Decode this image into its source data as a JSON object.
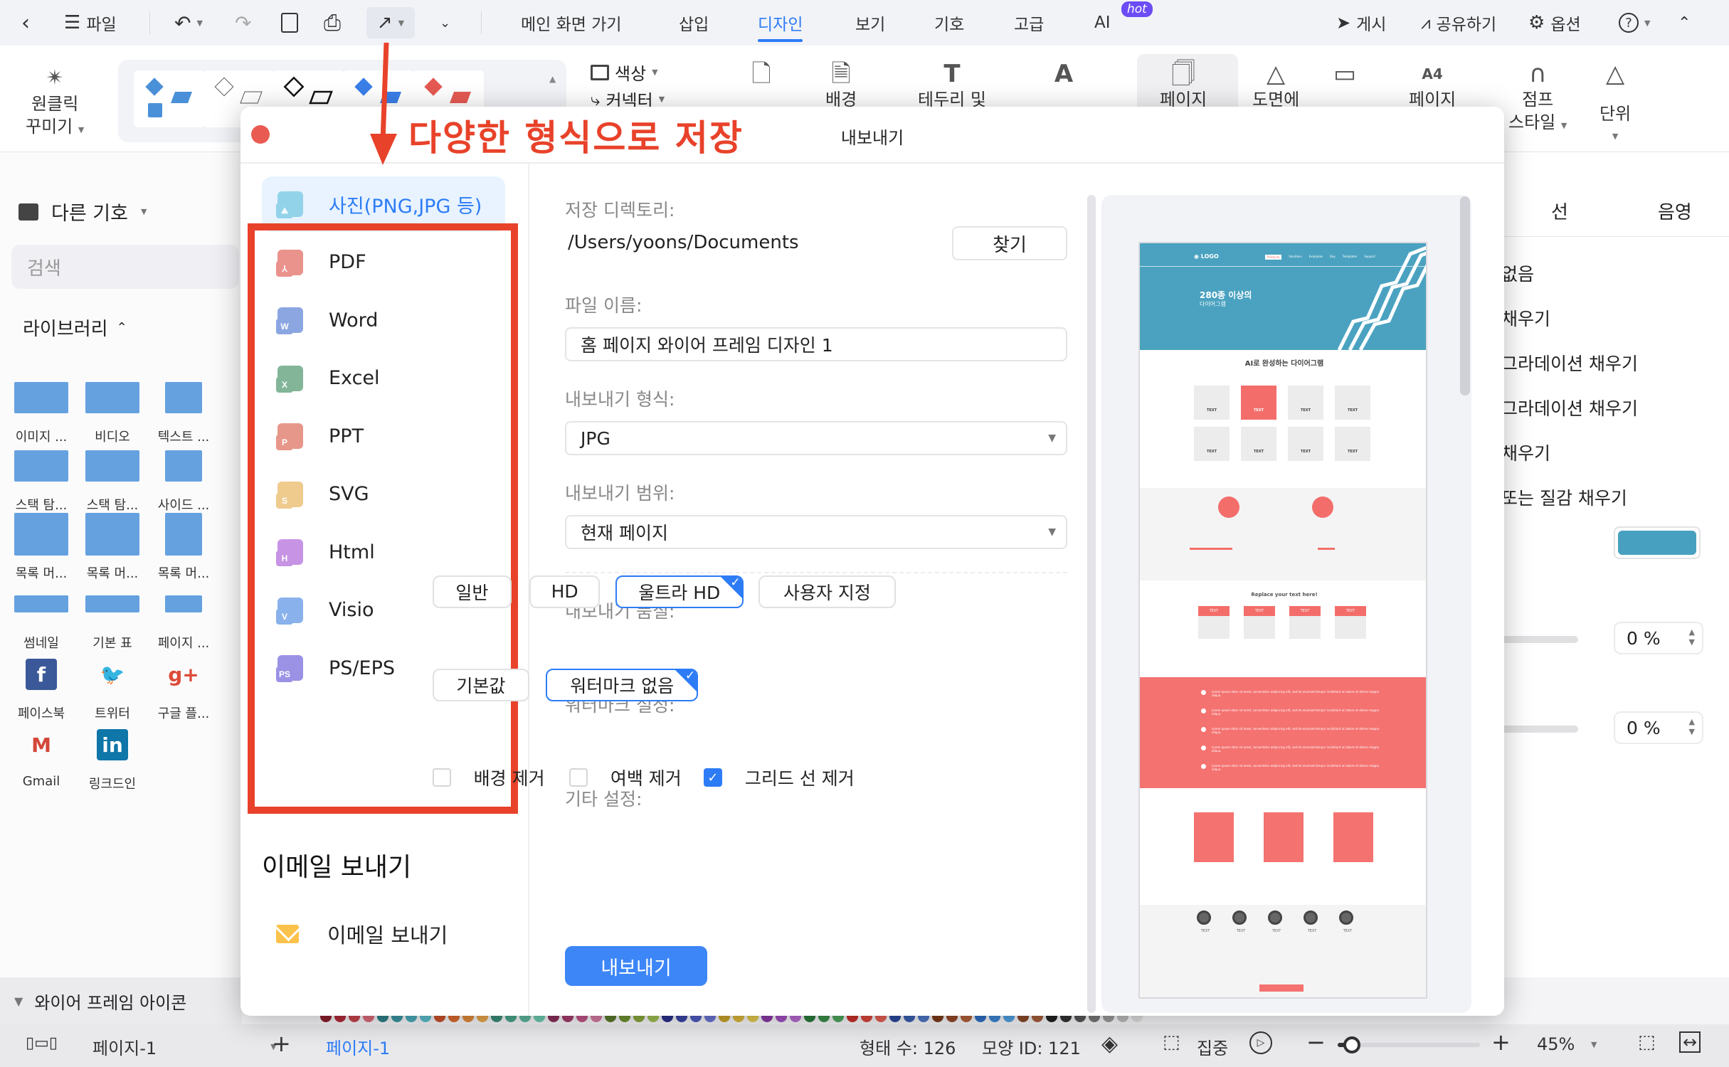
{
  "menubar": {
    "file_label": "파일",
    "tabs": [
      "메인 화면 가기",
      "삽입",
      "디자인",
      "보기",
      "기호",
      "고급",
      "AI"
    ],
    "active_tab": "디자인",
    "hot_badge": "hot",
    "publish_label": "게시",
    "share_label": "공유하기",
    "options_label": "옵션"
  },
  "ribbon": {
    "one_click_label_1": "원클릭",
    "one_click_label_2": "꾸미기",
    "color_label": "색상",
    "connector_label": "커넥터",
    "buttons": [
      "배경",
      "테두리 및",
      "페이지",
      "도면에",
      "페이지"
    ],
    "jump_style_1": "점프",
    "jump_style_2": "스타일",
    "unit_label": "단위"
  },
  "sidebar": {
    "more_symbols": "다른 기호",
    "search_placeholder": "검색",
    "library_label": "라이브러리",
    "items": [
      {
        "label": "이미지 ...",
        "icon": "image-text-thumb"
      },
      {
        "label": "비디오",
        "icon": "video-thumb"
      },
      {
        "label": "텍스트 ...",
        "icon": "text-thumb"
      },
      {
        "label": "스택 탐...",
        "icon": "stack-tab-thumb"
      },
      {
        "label": "스택 탐...",
        "icon": "stack-tab-thumb-2"
      },
      {
        "label": "사이드 ...",
        "icon": "side-thumb"
      },
      {
        "label": "목록 머...",
        "icon": "list-thumb"
      },
      {
        "label": "목록 머...",
        "icon": "list-thumb-2"
      },
      {
        "label": "목록 머...",
        "icon": "list-thumb-3"
      },
      {
        "label": "썸네일",
        "icon": "thumbnail-thumb"
      },
      {
        "label": "기본 표",
        "icon": "table-thumb"
      },
      {
        "label": "페이지 ...",
        "icon": "pagination-thumb"
      },
      {
        "label": "페이스북",
        "icon": "facebook-icon"
      },
      {
        "label": "트위터",
        "icon": "twitter-icon"
      },
      {
        "label": "구글 플...",
        "icon": "google-plus-icon"
      },
      {
        "label": "Gmail",
        "icon": "gmail-icon"
      },
      {
        "label": "링크드인",
        "icon": "linkedin-icon"
      }
    ],
    "wireframe_icons_label": "와이어 프레임 아이콘"
  },
  "right_panel": {
    "tabs": [
      "선",
      "음영"
    ],
    "fill_options": [
      "없음",
      "채우기",
      "그라데이션 채우기",
      "그라데이션 채우기",
      "채우기",
      "또는 질감 채우기"
    ],
    "fill_color": "#47a0bf",
    "percent_1": "0 %",
    "percent_2": "0 %"
  },
  "dialog": {
    "title": "내보내기",
    "annotation": "다양한 형식으로 저장",
    "formats": [
      {
        "label": "사진(PNG,JPG 등)",
        "badge": "",
        "color": "#4fb9d8",
        "selected": true
      },
      {
        "label": "PDF",
        "badge": "⅄",
        "color": "#d93a2f",
        "selected": false
      },
      {
        "label": "Word",
        "badge": "W",
        "color": "#2d5fc9",
        "selected": false
      },
      {
        "label": "Excel",
        "badge": "X",
        "color": "#1f7a45",
        "selected": false
      },
      {
        "label": "PPT",
        "badge": "P",
        "color": "#d4432a",
        "selected": false
      },
      {
        "label": "SVG",
        "badge": "S",
        "color": "#e3a132",
        "selected": false
      },
      {
        "label": "Html",
        "badge": "H",
        "color": "#9a3ccf",
        "selected": false
      },
      {
        "label": "Visio",
        "badge": "V",
        "color": "#2a73de",
        "selected": false
      },
      {
        "label": "PS/EPS",
        "badge": "PS",
        "color": "#4a3ad0",
        "selected": false
      }
    ],
    "email_section_title": "이메일 보내기",
    "email_item": "이메일 보내기",
    "save_dir_label": "저장 디렉토리:",
    "save_dir_value": "/Users/yoons/Documents",
    "browse_button": "찾기",
    "file_name_label": "파일 이름:",
    "file_name_value": "홈 페이지 와이어 프레임 디자인 1",
    "format_label": "내보내기 형식:",
    "format_value": "JPG",
    "range_label": "내보내기 범위:",
    "range_value": "현재 페이지",
    "quality_label": "내보내기 품질:",
    "quality_options": [
      "일반",
      "HD",
      "울트라 HD",
      "사용자 지정"
    ],
    "quality_selected": "울트라 HD",
    "watermark_label": "워터마크 설정:",
    "watermark_options": [
      "기본값",
      "워터마크 없음"
    ],
    "watermark_selected": "워터마크 없음",
    "other_label": "기타 설정:",
    "checkboxes": [
      {
        "label": "배경 제거",
        "checked": false
      },
      {
        "label": "여백 제거",
        "checked": false
      },
      {
        "label": "그리드 선 제거",
        "checked": true
      }
    ],
    "export_button": "내보내기"
  },
  "preview": {
    "hero_title": "280종 이상의",
    "hero_subtitle": "다이어그램",
    "nav_items": [
      "Products",
      "Solutions",
      "Examples",
      "Buy",
      "Templates",
      "Support"
    ],
    "section_title": "AI로 완성하는 다이어그램",
    "tile_label": "TEXT",
    "replace_text": "Replace your text here!",
    "list_text": "Lorem ipsum dolor sit amet, consectetur adipiscing elit, sed do eiusmod tempor incididunt ut labore et dolore magna aliqua."
  },
  "statusbar": {
    "page_selector": "페이지-1",
    "page_tab": "페이지-1",
    "shape_count": "형태 수: 126",
    "shape_id": "모양 ID: 121",
    "focus_label": "집중",
    "zoom_value": "45%",
    "zoom_level": 0.1
  }
}
